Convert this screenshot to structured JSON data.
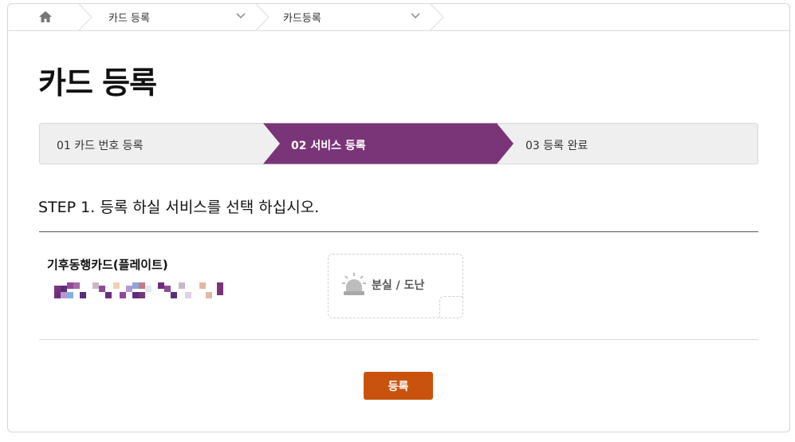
{
  "breadcrumb": {
    "home_icon": "home-icon",
    "items": [
      {
        "label": "카드 등록"
      },
      {
        "label": "카드등록"
      }
    ]
  },
  "page": {
    "title": "카드 등록"
  },
  "steps": [
    {
      "label": "01 카드 번호 등록",
      "active": false
    },
    {
      "label": "02 서비스 등록",
      "active": true
    },
    {
      "label": "03 등록 완료",
      "active": false
    }
  ],
  "section": {
    "title": "STEP 1. 등록 하실 서비스를 선택 하십시오."
  },
  "card": {
    "name": "기후동행카드(플레이트)",
    "number_masked": true
  },
  "service": {
    "label": "분실 / 도난",
    "icon": "siren-icon"
  },
  "actions": {
    "submit_label": "등록"
  },
  "colors": {
    "accent": "#7a3579",
    "button": "#c9530e"
  }
}
